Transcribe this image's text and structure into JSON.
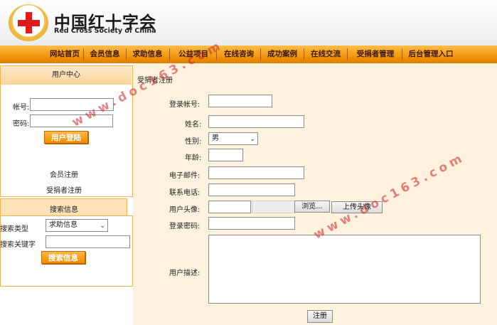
{
  "header": {
    "logo_cn": "中国红十字会",
    "logo_en": "Red Cross Society of China"
  },
  "nav": [
    "网站首页",
    "会员信息",
    "求助信息",
    "公益项目",
    "在线咨询",
    "成功案例",
    "在线交流",
    "受捐者管理",
    "后台管理入口"
  ],
  "user_center": {
    "title": "用户中心",
    "account_label": "帐号:",
    "password_label": "密码:",
    "login_button": "用户登陆",
    "register_member": "会员注册",
    "register_recipient": "受捐者注册"
  },
  "search": {
    "title": "搜索信息",
    "type_label": "搜索类型",
    "type_value": "求助信息",
    "keyword_label": "搜索关键字",
    "search_button": "搜索信息"
  },
  "form": {
    "breadcrumb": "受捐者注册",
    "login_account_label": "登录帐号:",
    "name_label": "姓名:",
    "gender_label": "性别:",
    "gender_value": "男",
    "age_label": "年龄:",
    "email_label": "电子邮件:",
    "phone_label": "联系电话:",
    "avatar_label": "用户头像:",
    "browse_button": "浏览...",
    "upload_button": "上传头像",
    "password_label": "登录密码:",
    "description_label": "用户描述:",
    "submit_button": "注册"
  },
  "watermark": "www.doc163.com"
}
